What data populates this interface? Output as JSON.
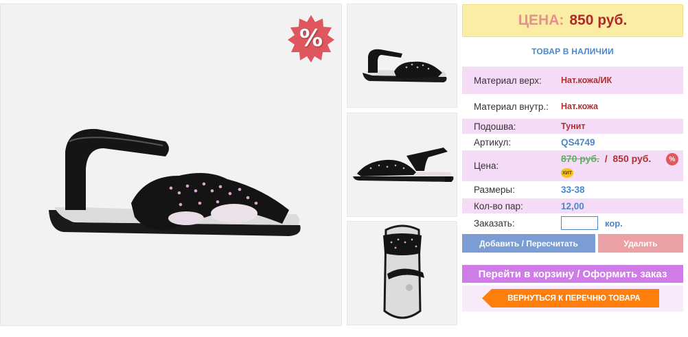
{
  "product": {
    "price_label": "ЦЕНА:",
    "price_value": "850 руб.",
    "stock_status": "ТОВАР В НАЛИЧИИ",
    "sale_badge": "%"
  },
  "specs": {
    "material_top": {
      "label": "Материал верх:",
      "value": "Нат.кожа/ИК"
    },
    "material_inner": {
      "label": "Материал внутр.:",
      "value": "Нат.кожа"
    },
    "sole": {
      "label": "Подошва:",
      "value": "Тунит"
    },
    "article": {
      "label": "Артикул:",
      "value": "QS4749"
    },
    "price": {
      "label": "Цена:",
      "old": "870 руб.",
      "separator": "/",
      "new": "850 руб.",
      "hit_badge": "ХИТ",
      "sale_mark": "%"
    },
    "sizes": {
      "label": "Размеры:",
      "value": "33-38"
    },
    "pairs": {
      "label": "Кол-во пар:",
      "value": "12,00"
    },
    "order": {
      "label": "Заказать:",
      "unit": "кор.",
      "value": ""
    }
  },
  "actions": {
    "add_label": "Добавить / Пересчитать",
    "delete_label": "Удалить",
    "cart_label": "Перейти в корзину / Оформить заказ",
    "back_label": "ВЕРНУТЬСЯ К ПЕРЕЧНЮ ТОВАРА"
  },
  "icons": {
    "sale": "percent-starburst-icon",
    "hit": "hit-badge-icon"
  },
  "colors": {
    "price_banner_bg": "#fbeea4",
    "price_value": "#b02a2a",
    "spec_shade": "#f4dcf7",
    "add_button": "#7c9dd3",
    "delete_button": "#eba0a6",
    "cart_button": "#cf7be8",
    "back_button": "#ff7f0e"
  }
}
